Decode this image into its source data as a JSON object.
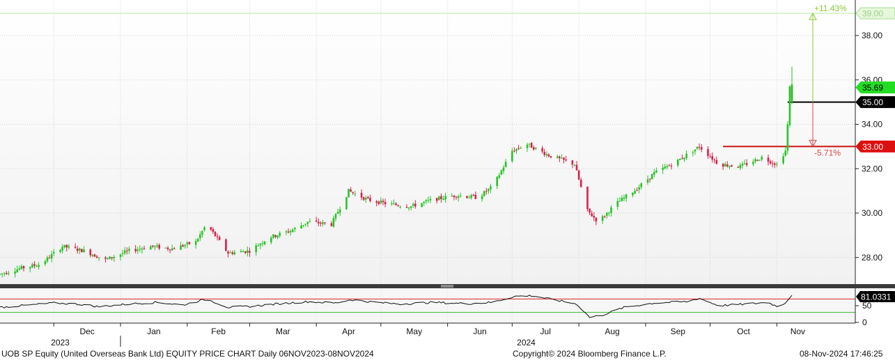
{
  "chart_data": {
    "type": "candlestick",
    "y_axis": {
      "min": 26.8,
      "max": 39.6,
      "ticks": [
        28.0,
        30.0,
        32.0,
        34.0,
        36.0,
        38.0
      ]
    },
    "x_axis": {
      "months": [
        {
          "label": "Dec",
          "date": "2023-12-01"
        },
        {
          "label": "Jan",
          "date": "2024-01-01"
        },
        {
          "label": "Feb",
          "date": "2024-02-01"
        },
        {
          "label": "Mar",
          "date": "2024-03-01"
        },
        {
          "label": "Apr",
          "date": "2024-04-01"
        },
        {
          "label": "May",
          "date": "2024-05-01"
        },
        {
          "label": "Jun",
          "date": "2024-06-01"
        },
        {
          "label": "Jul",
          "date": "2024-07-01"
        },
        {
          "label": "Aug",
          "date": "2024-08-01"
        },
        {
          "label": "Sep",
          "date": "2024-09-01"
        },
        {
          "label": "Oct",
          "date": "2024-10-01"
        },
        {
          "label": "Nov",
          "date": "2024-11-01"
        }
      ],
      "years": [
        {
          "label": "2023"
        },
        {
          "label": "2024"
        }
      ]
    },
    "trend_points": [
      [
        "2023-11-06",
        27.25
      ],
      [
        "2023-11-15",
        27.5
      ],
      [
        "2023-11-25",
        27.7
      ],
      [
        "2023-12-05",
        28.5
      ],
      [
        "2023-12-15",
        28.3
      ],
      [
        "2023-12-25",
        27.9
      ],
      [
        "2024-01-05",
        28.3
      ],
      [
        "2024-01-15",
        28.5
      ],
      [
        "2024-01-25",
        28.4
      ],
      [
        "2024-02-05",
        28.7
      ],
      [
        "2024-02-10",
        29.5
      ],
      [
        "2024-02-20",
        28.2
      ],
      [
        "2024-03-01",
        28.3
      ],
      [
        "2024-03-10",
        28.9
      ],
      [
        "2024-03-20",
        29.2
      ],
      [
        "2024-03-28",
        29.6
      ],
      [
        "2024-04-08",
        29.5
      ],
      [
        "2024-04-16",
        31.0
      ],
      [
        "2024-04-25",
        30.6
      ],
      [
        "2024-05-05",
        30.4
      ],
      [
        "2024-05-15",
        30.3
      ],
      [
        "2024-05-25",
        30.6
      ],
      [
        "2024-06-05",
        30.8
      ],
      [
        "2024-06-15",
        30.7
      ],
      [
        "2024-06-22",
        31.2
      ],
      [
        "2024-07-01",
        32.8
      ],
      [
        "2024-07-08",
        33.1
      ],
      [
        "2024-07-18",
        32.6
      ],
      [
        "2024-07-30",
        32.2
      ],
      [
        "2024-08-05",
        30.1
      ],
      [
        "2024-08-10",
        29.6
      ],
      [
        "2024-08-18",
        30.4
      ],
      [
        "2024-08-28",
        31.1
      ],
      [
        "2024-09-05",
        31.8
      ],
      [
        "2024-09-15",
        32.3
      ],
      [
        "2024-09-26",
        33.0
      ],
      [
        "2024-10-05",
        32.2
      ],
      [
        "2024-10-15",
        32.1
      ],
      [
        "2024-10-25",
        32.5
      ],
      [
        "2024-11-01",
        32.2
      ],
      [
        "2024-11-05",
        32.8
      ],
      [
        "2024-11-06",
        34.0
      ],
      [
        "2024-11-07",
        35.7
      ],
      [
        "2024-11-08",
        35.1
      ]
    ],
    "hlines": [
      {
        "y": 39.0,
        "color": "#b9e9a0",
        "from": "2023-11-06",
        "label": "39.00",
        "label_bg": "#e6f7dc",
        "label_color": "#9ecf88"
      },
      {
        "y": 35.0,
        "color": "#000000",
        "from": "2024-11-06",
        "label": "35.00",
        "label_bg": "#000000",
        "label_color": "#ffffff"
      },
      {
        "y": 33.0,
        "color": "#cc1010",
        "from": "2024-10-07",
        "label": "33.00",
        "label_bg": "#dd1010",
        "label_color": "#ffffff"
      }
    ],
    "last_price": {
      "value": 35.69,
      "label": "35.69",
      "bg": "#22dd22",
      "color": "#000000"
    },
    "annotations": [
      {
        "type": "arrow",
        "date": "2024-11-08",
        "from": 35.0,
        "to": 39.0,
        "color": "#88cc33",
        "label": "+11.43%"
      },
      {
        "type": "arrow",
        "date": "2024-11-08",
        "from": 35.0,
        "to": 33.0,
        "color": "#dd4444",
        "label": "-5.71%"
      }
    ],
    "rsi": {
      "ticks": [
        0,
        50
      ],
      "upper_line": 70,
      "lower_line": 30,
      "last_label": "81.0331",
      "points": [
        [
          "2023-11-06",
          45
        ],
        [
          "2023-11-20",
          52
        ],
        [
          "2023-12-01",
          58
        ],
        [
          "2023-12-12",
          55
        ],
        [
          "2023-12-22",
          47
        ],
        [
          "2024-01-05",
          55
        ],
        [
          "2024-01-18",
          60
        ],
        [
          "2024-01-30",
          52
        ],
        [
          "2024-02-10",
          70
        ],
        [
          "2024-02-20",
          45
        ],
        [
          "2024-03-01",
          48
        ],
        [
          "2024-03-15",
          56
        ],
        [
          "2024-03-28",
          62
        ],
        [
          "2024-04-10",
          58
        ],
        [
          "2024-04-17",
          68
        ],
        [
          "2024-04-28",
          60
        ],
        [
          "2024-05-10",
          55
        ],
        [
          "2024-05-25",
          60
        ],
        [
          "2024-06-10",
          56
        ],
        [
          "2024-06-22",
          60
        ],
        [
          "2024-07-02",
          78
        ],
        [
          "2024-07-10",
          80
        ],
        [
          "2024-07-22",
          66
        ],
        [
          "2024-07-31",
          55
        ],
        [
          "2024-08-06",
          15
        ],
        [
          "2024-08-12",
          22
        ],
        [
          "2024-08-22",
          45
        ],
        [
          "2024-09-05",
          58
        ],
        [
          "2024-09-20",
          62
        ],
        [
          "2024-09-26",
          72
        ],
        [
          "2024-10-05",
          50
        ],
        [
          "2024-10-18",
          55
        ],
        [
          "2024-10-28",
          60
        ],
        [
          "2024-11-01",
          48
        ],
        [
          "2024-11-05",
          58
        ],
        [
          "2024-11-08",
          81.03
        ]
      ]
    }
  },
  "footer": {
    "left": "UOB SP Equity (United Overseas Bank Ltd) EQUITY PRICE CHART  Daily 06NOV2023-08NOV2024",
    "center": "Copyright© 2024 Bloomberg Finance L.P.",
    "right": "08-Nov-2024 17:46:25"
  }
}
